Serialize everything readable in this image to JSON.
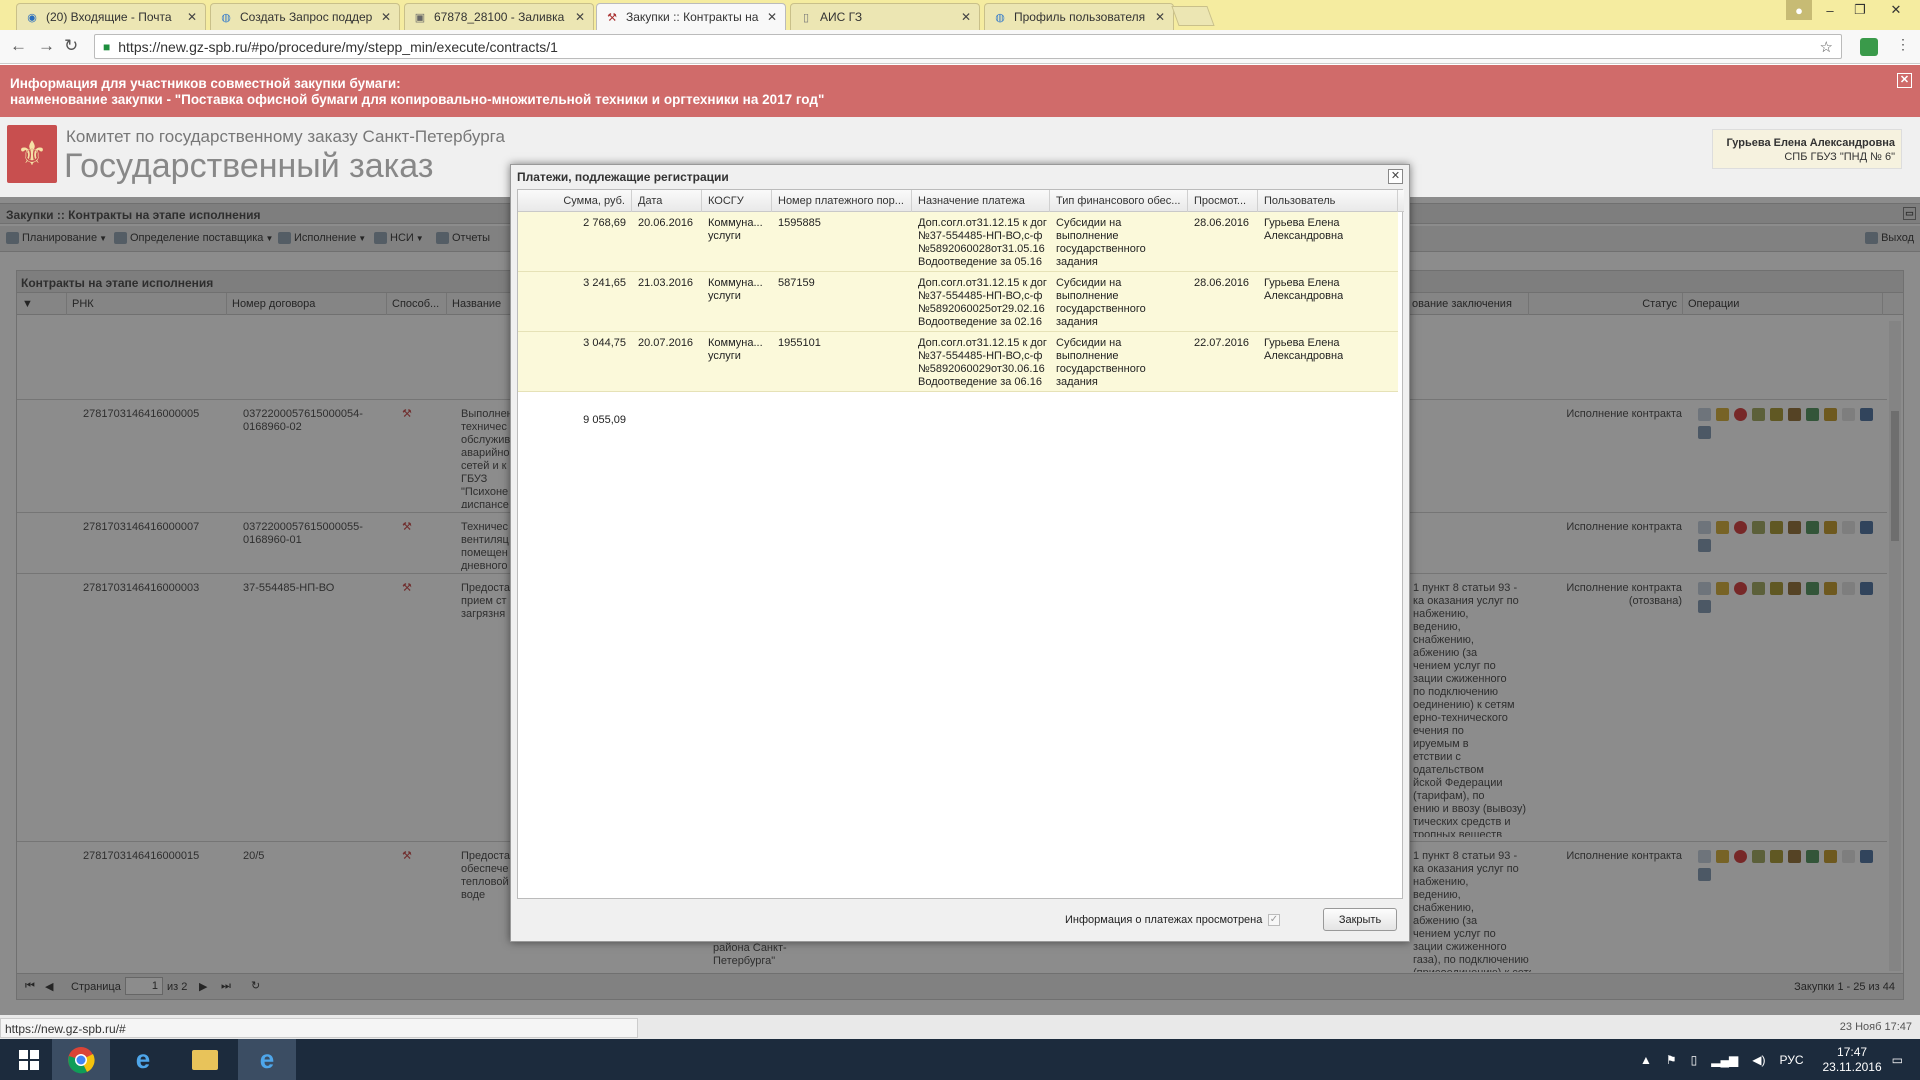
{
  "browser": {
    "tabs": [
      {
        "title": "(20) Входящие - Почта",
        "icon": "mail-icon"
      },
      {
        "title": "Создать Запрос поддер",
        "icon": "globe-icon"
      },
      {
        "title": "67878_28100 - Заливка",
        "icon": "image-icon"
      },
      {
        "title": "Закупки :: Контракты на",
        "icon": "hammer-icon",
        "active": true
      },
      {
        "title": "АИС ГЗ",
        "icon": "page-icon"
      },
      {
        "title": "Профиль пользователя",
        "icon": "globe-icon"
      }
    ],
    "url": "https://new.gz-spb.ru/#po/procedure/my/stepp_min/execute/contracts/1"
  },
  "banner": {
    "line1": "Информация для участников совместной закупки бумаги:",
    "line2": "наименование закупки - \"Поставка офисной бумаги для копировально-множительной техники и оргтехники на 2017 год\"",
    "close": "✕"
  },
  "header": {
    "org": "Комитет по государственному заказу Санкт-Петербурга",
    "title": "Государственный заказ",
    "user_name": "Гурьева Елена Александровна",
    "user_org": "СПБ ГБУЗ \"ПНД № 6\""
  },
  "section": {
    "title": "Закупки :: Контракты на этапе исполнения",
    "menu": [
      "Планирование",
      "Определение поставщика",
      "Исполнение",
      "НСИ",
      "Отчеты"
    ],
    "exit": "Выход"
  },
  "grid": {
    "title": "Контракты на этапе исполнения",
    "columns": [
      "РНК",
      "Номер договора",
      "Способ...",
      "Название",
      "ование заключения",
      "Статус",
      "Операции"
    ],
    "rows": [
      {
        "rnk": "2781703146416000005",
        "num": "0372200057615000054-\n0168960-02",
        "name": "Выполнен\nтехничес\nобслужив\nаварийно\nсетей и к\nГБУЗ\n\"Психоне\nдиспансе",
        "basis": "",
        "status": "Исполнение контракта"
      },
      {
        "rnk": "2781703146416000007",
        "num": "0372200057615000055-\n0168960-01",
        "name": "Техничес\nвентиляц\nпомещен\nдневного",
        "basis": "",
        "status": "Исполнение контракта"
      },
      {
        "rnk": "2781703146416000003",
        "num": "37-554485-НП-ВО",
        "name": "Предоста\nприем ст\nзагрязня",
        "basis": "1 пункт 8 статьи 93 -\nка оказания услуг по\nнабжению,\nведению,\nснабжению,\nабжению (за\nчением услуг по\nзации сжиженного\nпо подключению\nоединению) к сетям\nерно-технического\nечения по\nируемым в\nетствии с\nодательством\nйской Федерации\n(тарифам), по\nению и ввозу (вывозу)\nтических средств и\nтропных веществ",
        "status": "Исполнение контракта\n(отозвана)"
      },
      {
        "rnk": "2781703146416000015",
        "num": "20/5",
        "name": "Предоста\nобеспече\nтепловой\nводе",
        "basis": "1 пункт 8 статьи 93 -\nка оказания услуг по\nнабжению,\nведению,\nснабжению,\nабжению (за\nчением услуг по\nзации сжиженного\nгаза), по подключению\n(присоединению) к сетям",
        "extra": "района Санкт-\nПетербурга\"",
        "status": "Исполнение контракта"
      }
    ],
    "pager": {
      "page_label": "Страница",
      "page": "1",
      "of": "из 2",
      "summary": "Закупки 1 - 25 из 44"
    }
  },
  "modal": {
    "title": "Платежи, подлежащие регистрации",
    "columns": [
      "Сумма, руб.",
      "Дата",
      "КОСГУ",
      "Номер платежного пор...",
      "Назначение платежа",
      "Тип финансового обес...",
      "Просмот...",
      "Пользователь"
    ],
    "rows": [
      {
        "sum": "2 768,69",
        "date": "20.06.2016",
        "kosgu": "Коммуна...\nуслуги",
        "order": "1595885",
        "purpose": "Доп.согл.от31.12.15 к дог\n№37-554485-НП-ВО,с-ф\n№5892060028от31.05.16\nВодоотведение за 05.16",
        "fin": "Субсидии на\nвыполнение\nгосударственного\nзадания",
        "viewed": "28.06.2016",
        "user": "Гурьева Елена\nАлександровна"
      },
      {
        "sum": "3 241,65",
        "date": "21.03.2016",
        "kosgu": "Коммуна...\nуслуги",
        "order": "587159",
        "purpose": "Доп.согл.от31.12.15 к дог\n№37-554485-НП-ВО,с-ф\n№5892060025от29.02.16\nВодоотведение за 02.16",
        "fin": "Субсидии на\nвыполнение\nгосударственного\nзадания",
        "viewed": "28.06.2016",
        "user": "Гурьева Елена\nАлександровна"
      },
      {
        "sum": "3 044,75",
        "date": "20.07.2016",
        "kosgu": "Коммуна...\nуслуги",
        "order": "1955101",
        "purpose": "Доп.согл.от31.12.15 к дог\n№37-554485-НП-ВО,с-ф\n№5892060029от30.06.16\nВодоотведение за 06.16",
        "fin": "Субсидии на\nвыполнение\nгосударственного\nзадания",
        "viewed": "22.07.2016",
        "user": "Гурьева Елена\nАлександровна"
      }
    ],
    "total": "9 055,09",
    "viewed_label": "Информация о платежах просмотрена",
    "close_button": "Закрыть"
  },
  "status": {
    "url": "https://new.gz-spb.ru/#",
    "time": "23 Нояб 17:47"
  },
  "taskbar": {
    "lang": "РУС",
    "time": "17:47",
    "date": "23.11.2016"
  }
}
